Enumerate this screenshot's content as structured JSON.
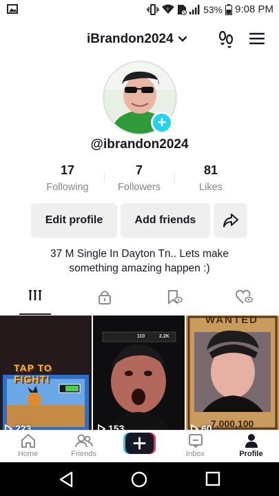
{
  "status_bar": {
    "battery": "53%",
    "time": "9:08 PM",
    "icons": [
      "gallery-icon",
      "vibrate-icon",
      "wifi-icon",
      "no-sim-icon",
      "signal-icon",
      "battery-icon"
    ]
  },
  "header": {
    "username": "iBrandon2024",
    "icons": [
      "chevron-down-icon",
      "footprints-icon",
      "menu-icon"
    ]
  },
  "profile": {
    "handle": "@ibrandon2024",
    "bio_line1": "37 M Single In Dayton Tn.. Lets make",
    "bio_line2": "something amazing happen :)"
  },
  "stats": [
    {
      "value": "17",
      "label": "Following"
    },
    {
      "value": "7",
      "label": "Followers"
    },
    {
      "value": "81",
      "label": "Likes"
    }
  ],
  "actions": {
    "edit_profile": "Edit profile",
    "add_friends": "Add friends"
  },
  "tabs": [
    "videos-grid-icon",
    "lock-icon",
    "saved-icon",
    "liked-icon"
  ],
  "videos": [
    {
      "views": "223",
      "overlay_text": "TAP TO FIGHT!"
    },
    {
      "views": "153",
      "overlay_text": "110",
      "overlay_text2": "2.2K"
    },
    {
      "views": "60",
      "overlay_top": "WANTED",
      "overlay_bottom": "7,000,100"
    }
  ],
  "bottom_nav": {
    "home": "Home",
    "friends": "Friends",
    "inbox": "Inbox",
    "profile": "Profile"
  },
  "colors": {
    "accent_cyan": "#20d5ec",
    "accent_pink": "#fe2c55",
    "text": "#161823",
    "muted": "#86878b"
  }
}
